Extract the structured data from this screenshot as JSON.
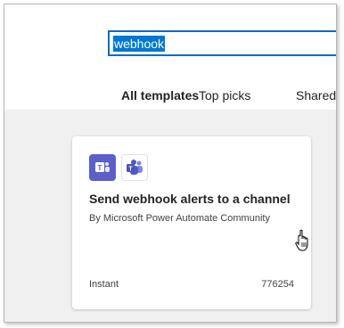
{
  "search": {
    "value": "webhook"
  },
  "tabs": [
    {
      "label": "All templates",
      "selected": true
    },
    {
      "label": "Top picks",
      "selected": false
    },
    {
      "label": "Shared",
      "selected": false
    }
  ],
  "template_card": {
    "icons": [
      "teams-icon",
      "teams-icon"
    ],
    "title": "Send webhook alerts to a channel",
    "author": "By Microsoft Power Automate Community",
    "type": "Instant",
    "count": "776254"
  },
  "colors": {
    "accent": "#0f6cbd",
    "selection": "#0078d4",
    "teams_purple": "#5b5fc7",
    "gallery_bg": "#f0f0f0"
  }
}
